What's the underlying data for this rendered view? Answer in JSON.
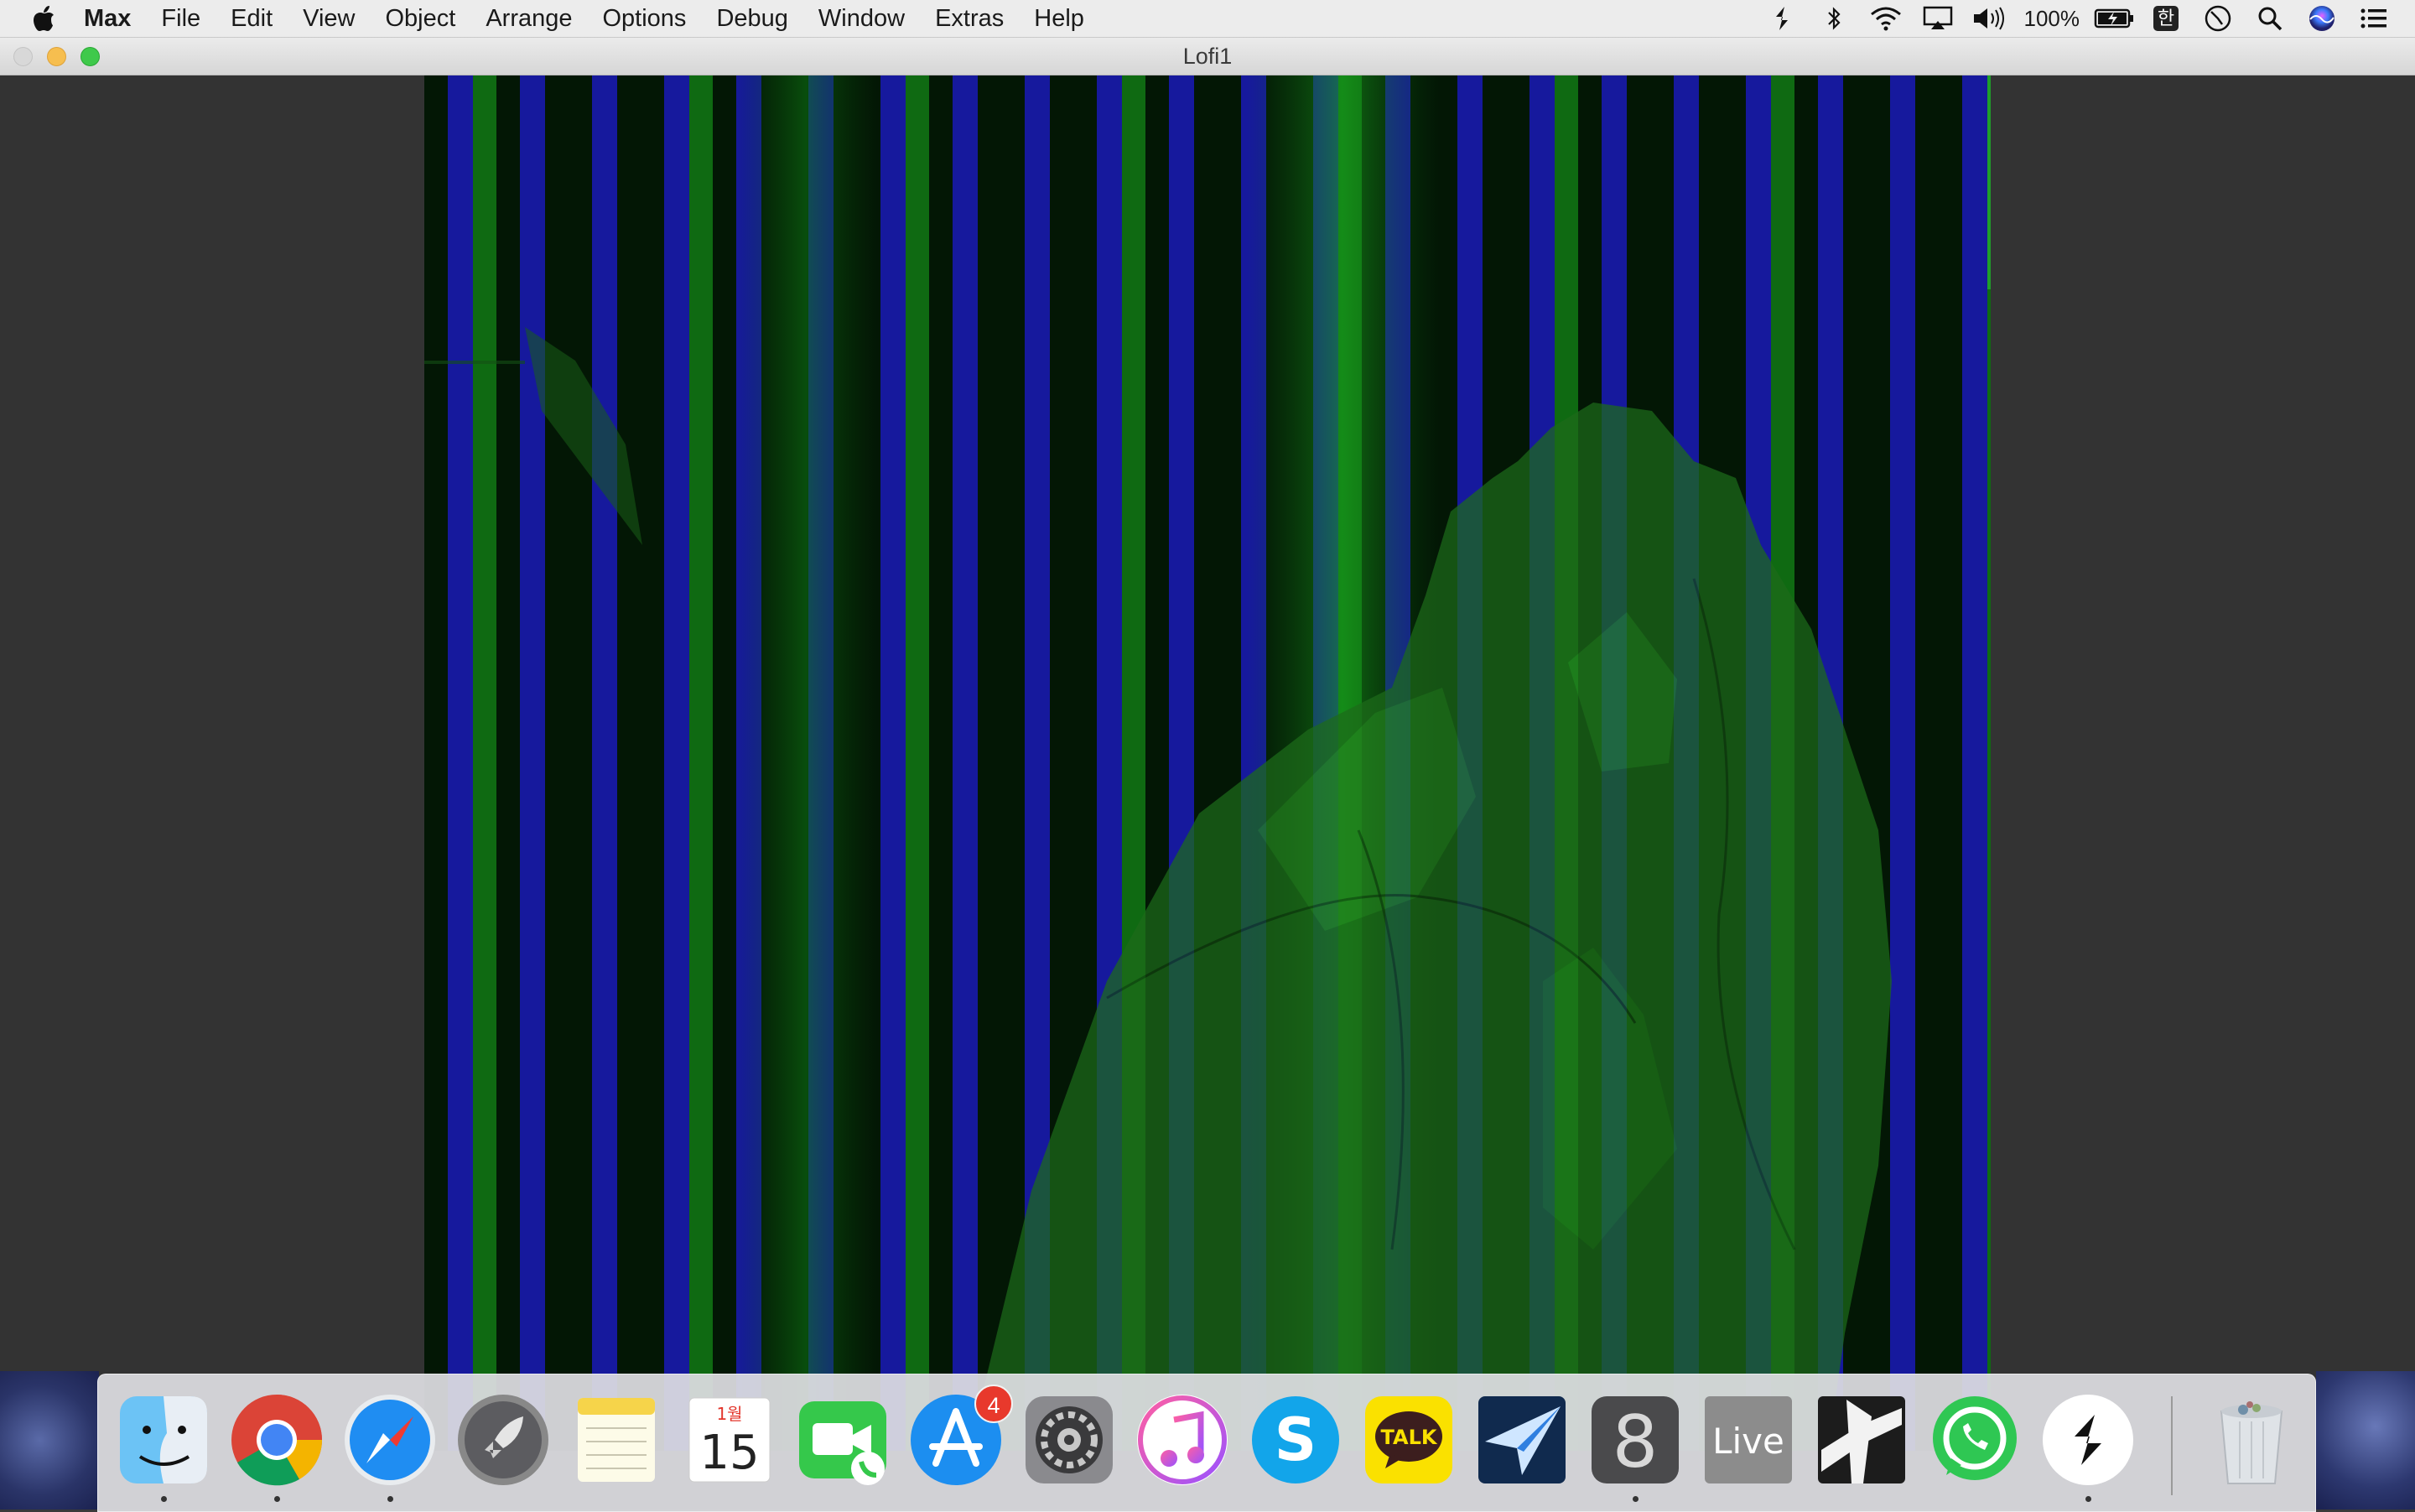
{
  "menubar": {
    "app_name": "Max",
    "items": [
      "File",
      "Edit",
      "View",
      "Object",
      "Arrange",
      "Options",
      "Debug",
      "Window",
      "Extras",
      "Help"
    ],
    "status": {
      "battery_percent": "100%",
      "input_method": "한",
      "icons": [
        "app-status-icon",
        "bluetooth-icon",
        "wifi-icon",
        "airplay-icon",
        "volume-icon",
        "battery-charging-icon",
        "input-method-icon",
        "clock-icon",
        "spotlight-icon",
        "siri-icon",
        "notification-center-icon"
      ]
    }
  },
  "window": {
    "title": "Lofi1"
  },
  "dock": {
    "apps": [
      {
        "name": "Finder",
        "icon": "finder-icon",
        "running": true
      },
      {
        "name": "Google Chrome",
        "icon": "chrome-icon",
        "running": true
      },
      {
        "name": "Safari",
        "icon": "safari-icon",
        "running": true
      },
      {
        "name": "Launchpad",
        "icon": "launchpad-icon",
        "running": false
      },
      {
        "name": "Notes",
        "icon": "notes-icon",
        "running": false
      },
      {
        "name": "Calendar",
        "icon": "calendar-icon",
        "running": false,
        "month": "1월",
        "day": "15"
      },
      {
        "name": "FaceTime",
        "icon": "facetime-icon",
        "running": false
      },
      {
        "name": "App Store",
        "icon": "app-store-icon",
        "running": false,
        "badge": "4"
      },
      {
        "name": "System Preferences",
        "icon": "system-preferences-icon",
        "running": false
      },
      {
        "name": "iTunes",
        "icon": "itunes-icon",
        "running": false
      },
      {
        "name": "Skype",
        "icon": "skype-icon",
        "running": false
      },
      {
        "name": "KakaoTalk",
        "icon": "kakaotalk-icon",
        "running": false,
        "label": "TALK"
      },
      {
        "name": "Airmail",
        "icon": "airmail-icon",
        "running": false
      },
      {
        "name": "Max 8",
        "icon": "max8-icon",
        "running": true,
        "label": "8"
      },
      {
        "name": "Ableton Live",
        "icon": "ableton-live-icon",
        "running": false,
        "label": "Live"
      },
      {
        "name": "Sonic Visualiser",
        "icon": "sonic-app-icon",
        "running": false
      },
      {
        "name": "WhatsApp",
        "icon": "whatsapp-icon",
        "running": false
      },
      {
        "name": "Splice",
        "icon": "splice-icon",
        "running": true
      },
      {
        "name": "Trash",
        "icon": "trash-icon",
        "running": false
      }
    ]
  },
  "colors": {
    "stripe_blue": "#1a1ab8",
    "stripe_green": "#0f6a12",
    "stripe_dark": "#031705",
    "figure_green": "#1d6b1a"
  }
}
